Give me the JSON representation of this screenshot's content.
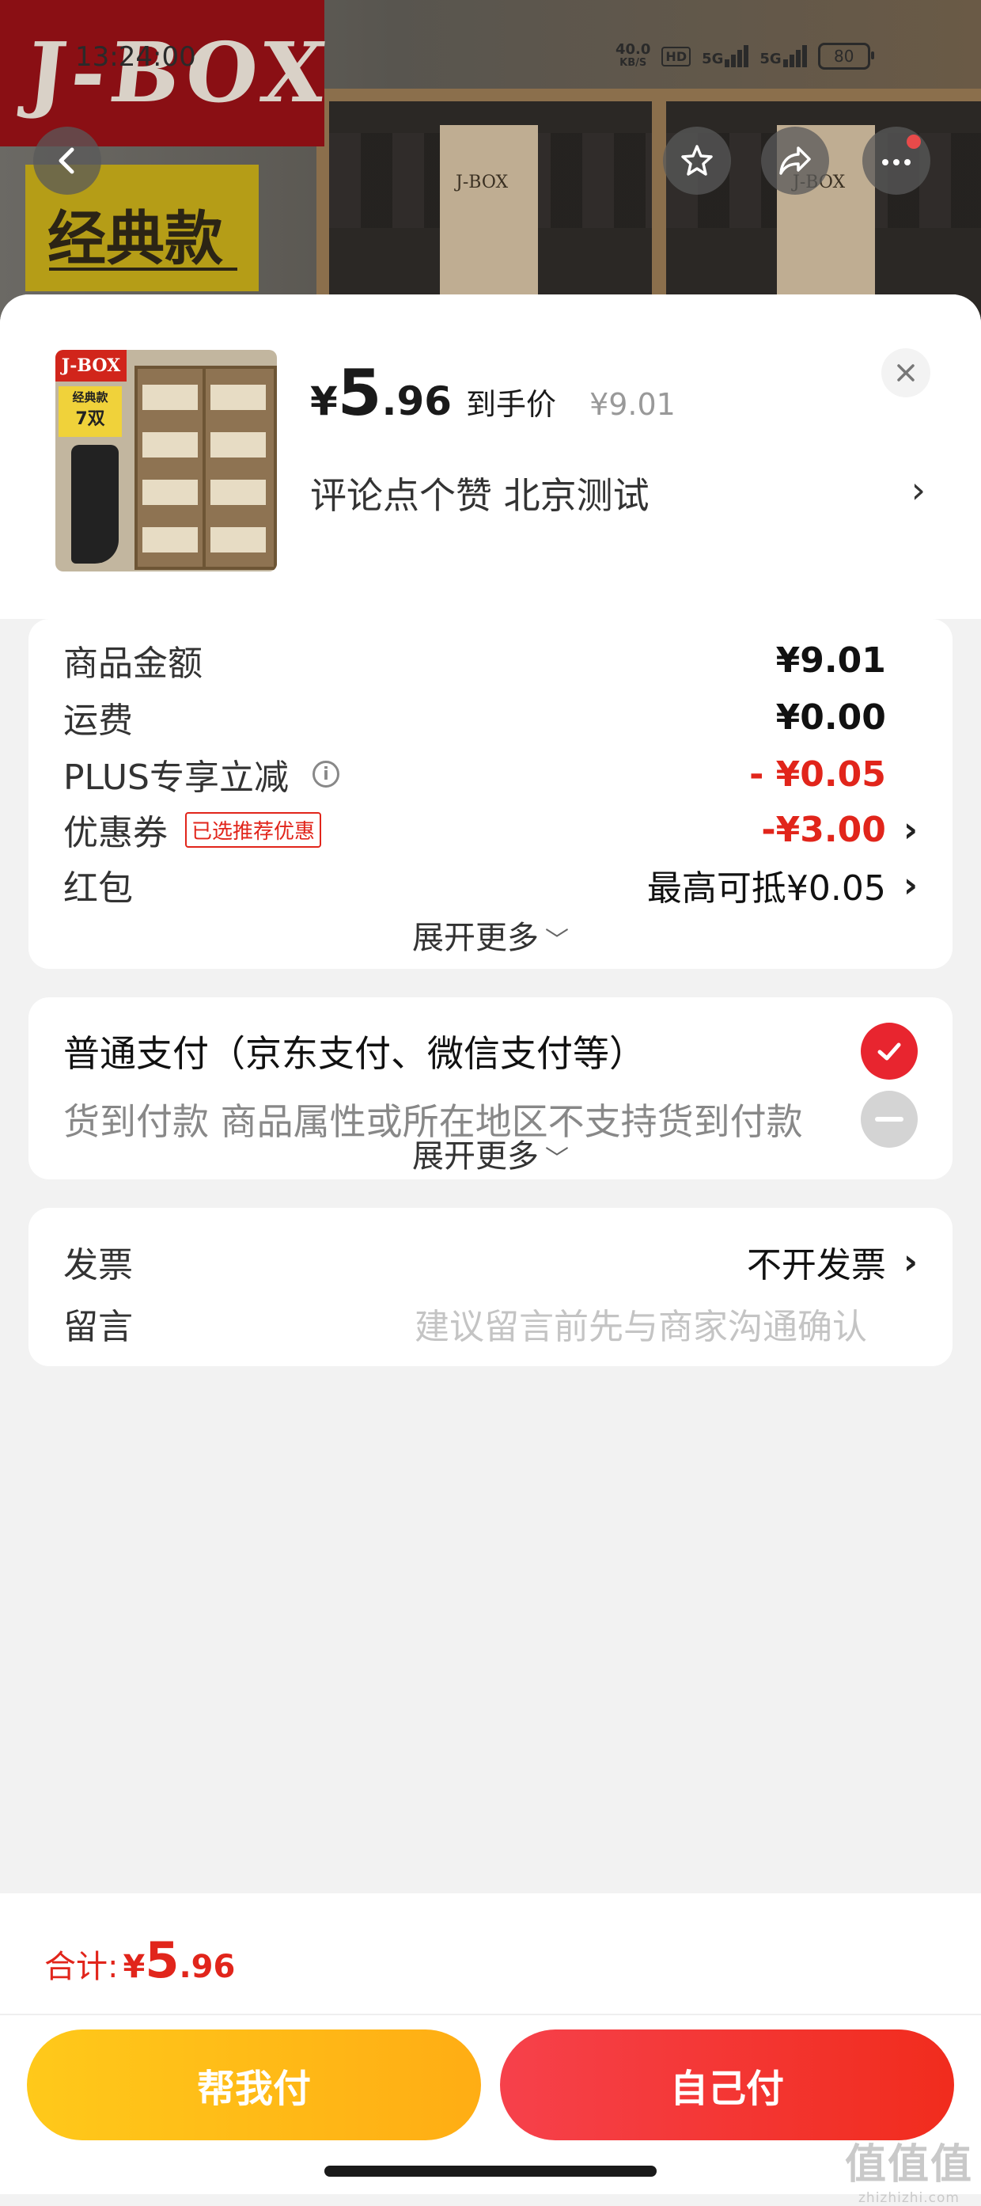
{
  "status_bar": {
    "time": "13:24:00",
    "net_speed_value": "40.0",
    "net_speed_unit": "KB/S",
    "hd_label": "HD",
    "signal1_label": "5G",
    "signal2_label": "5G",
    "battery": "80"
  },
  "background_page": {
    "brand_logo": "J-BOX",
    "tag": "经典款",
    "icons": [
      "back-arrow-icon",
      "star-icon",
      "share-icon",
      "more-icon"
    ]
  },
  "product": {
    "thumb_logo": "J-BOX",
    "thumb_tag_line1": "经典款",
    "thumb_tag_line2": "7双",
    "price_symbol": "¥",
    "price_integer": "5",
    "price_decimal": ".96",
    "price_label": "到手价",
    "original_price": "¥9.01",
    "spec": "评论点个赞  北京测试",
    "spec_arrow": "›",
    "close_icon": "close-icon"
  },
  "cost_card": {
    "rows": [
      {
        "label": "商品金额",
        "value": "¥9.01"
      },
      {
        "label": "运费",
        "value": "¥0.00"
      },
      {
        "label": "PLUS专享立减",
        "value": "- ¥0.05"
      },
      {
        "label": "优惠券",
        "badge": "已选推荐优惠",
        "value": "-¥3.00",
        "arrow": "›"
      },
      {
        "label": "红包",
        "value": "最高可抵¥0.05",
        "arrow": "›"
      }
    ],
    "expand_label": "展开更多",
    "expand_chevron": "﹀",
    "accent_color": "#e1251b"
  },
  "payment_card": {
    "options": [
      {
        "label": "普通支付（京东支付、微信支付等）",
        "selected": true
      },
      {
        "label": "货到付款 商品属性或所在地区不支持货到付款",
        "selected": false
      }
    ],
    "expand_label": "展开更多",
    "expand_chevron": "﹀"
  },
  "extra_card": {
    "invoice_label": "发票",
    "invoice_value": "不开发票",
    "invoice_arrow": "›",
    "message_label": "留言",
    "message_placeholder": "建议留言前先与商家沟通确认"
  },
  "bottom_bar": {
    "total_label": "合计:",
    "total_symbol": "¥",
    "total_integer": "5",
    "total_decimal": ".96",
    "help_pay_label": "帮我付",
    "self_pay_label": "自己付",
    "help_pay_color": "#ffb81a",
    "self_pay_color": "#f3333b"
  },
  "watermark": {
    "mark": "值值值",
    "url": "zhizhizhi.com"
  }
}
